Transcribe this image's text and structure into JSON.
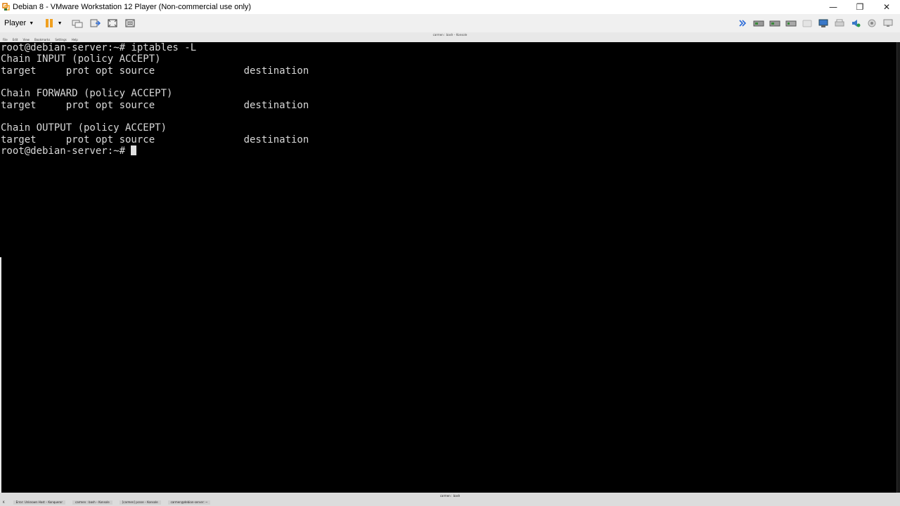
{
  "window": {
    "title": "Debian 8 - VMware Workstation 12 Player (Non-commercial use only)",
    "minimize_glyph": "—",
    "restore_glyph": "❐",
    "close_glyph": "✕"
  },
  "toolbar": {
    "player_label": "Player",
    "player_caret": "▼",
    "pause_caret": "▼",
    "left_icons": [
      "pause-icon",
      "send-ctrl-alt-del-icon",
      "removable-devices-icon",
      "fullscreen-icon",
      "unity-icon"
    ],
    "right_icons": [
      "forward-arrows-icon",
      "hard-disk-icon",
      "hard-disk-icon",
      "cd-dvd-icon",
      "floppy-icon",
      "network-adapter-icon",
      "printer-icon",
      "sound-card-icon",
      "camera-icon",
      "display-icon"
    ]
  },
  "guest": {
    "window_title": "carmen : bash – Konsole",
    "menu": [
      "File",
      "Edit",
      "View",
      "Bookmarks",
      "Settings",
      "Help"
    ]
  },
  "terminal": {
    "lines": [
      "root@debian-server:~# iptables -L",
      "Chain INPUT (policy ACCEPT)",
      "target     prot opt source               destination",
      "",
      "Chain FORWARD (policy ACCEPT)",
      "target     prot opt source               destination",
      "",
      "Chain OUTPUT (policy ACCEPT)",
      "target     prot opt source               destination",
      "root@debian-server:~# "
    ]
  },
  "taskbar": {
    "tray_title": "carmen : bash",
    "start_label": "K",
    "items": [
      "Error: Unknown Host – Konqueror",
      "carmen : bash – Konsole",
      "[carmen] pcsse – Konsole",
      "carmen@debian-server: ~"
    ],
    "clock": ""
  },
  "colors": {
    "terminal_bg": "#000000",
    "terminal_fg": "#d8d8d8",
    "titlebar_bg": "#ffffff",
    "toolbar_bg": "#f0f0f0",
    "pause_orange": "#f0a020",
    "accent_blue": "#2a6ad8"
  }
}
